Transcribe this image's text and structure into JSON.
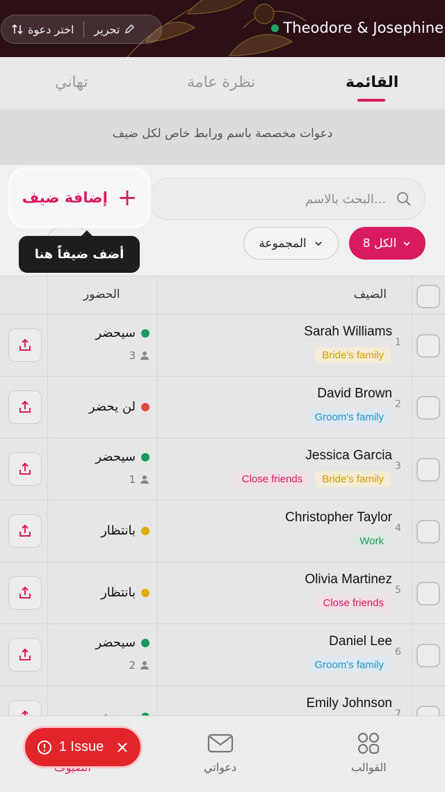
{
  "header": {
    "title": "Theodore & Josephine",
    "edit_label": "تحرير",
    "choose_invite_label": "اختر دعوة"
  },
  "tabs": [
    {
      "label": "القائمة",
      "active": true
    },
    {
      "label": "نظرة عامة",
      "active": false
    },
    {
      "label": "تهاني",
      "active": false
    }
  ],
  "info_text": "دعوات مخصصة باسم ورابط خاص لكل ضيف",
  "search": {
    "placeholder": "البحث بالاسم..."
  },
  "add_guest_label": "إضافة ضيف",
  "tooltip": "أضف ضيفاً هنا",
  "filters": {
    "all_label": "الكل 8",
    "group_label": "المجموعة"
  },
  "table": {
    "col_guest": "الضيف",
    "col_attendance": "الحضور",
    "rows": [
      {
        "num": "1",
        "name": "Sarah Williams",
        "tags": [
          {
            "label": "Bride's family",
            "kind": "bride"
          }
        ],
        "status": "سيحضر",
        "status_color": "#1a9a5e",
        "count": "3"
      },
      {
        "num": "2",
        "name": "David Brown",
        "tags": [
          {
            "label": "Groom's family",
            "kind": "groom"
          }
        ],
        "status": "لن يحضر",
        "status_color": "#e04848",
        "count": ""
      },
      {
        "num": "3",
        "name": "Jessica Garcia",
        "tags": [
          {
            "label": "Bride's family",
            "kind": "bride"
          },
          {
            "label": "Close friends",
            "kind": "close"
          }
        ],
        "status": "سيحضر",
        "status_color": "#1a9a5e",
        "count": "1"
      },
      {
        "num": "4",
        "name": "Christopher Taylor",
        "tags": [
          {
            "label": "Work",
            "kind": "work"
          }
        ],
        "status": "بانتظار",
        "status_color": "#e0ac00",
        "count": ""
      },
      {
        "num": "5",
        "name": "Olivia Martinez",
        "tags": [
          {
            "label": "Close friends",
            "kind": "close"
          }
        ],
        "status": "بانتظار",
        "status_color": "#e0ac00",
        "count": ""
      },
      {
        "num": "6",
        "name": "Daniel Lee",
        "tags": [
          {
            "label": "Groom's family",
            "kind": "groom"
          }
        ],
        "status": "سيحضر",
        "status_color": "#1a9a5e",
        "count": "2"
      },
      {
        "num": "7",
        "name": "Emily Johnson",
        "tags": [],
        "status": "سيحضر",
        "status_color": "#1a9a5e",
        "count": ""
      }
    ]
  },
  "bottom_nav": {
    "templates_label": "القوالب",
    "invites_label": "دعواتي",
    "guests_label": "الضيوف"
  },
  "issue_badge": "1 Issue",
  "colors": {
    "accent": "#d81b60",
    "header_bg": "#2b1015"
  }
}
